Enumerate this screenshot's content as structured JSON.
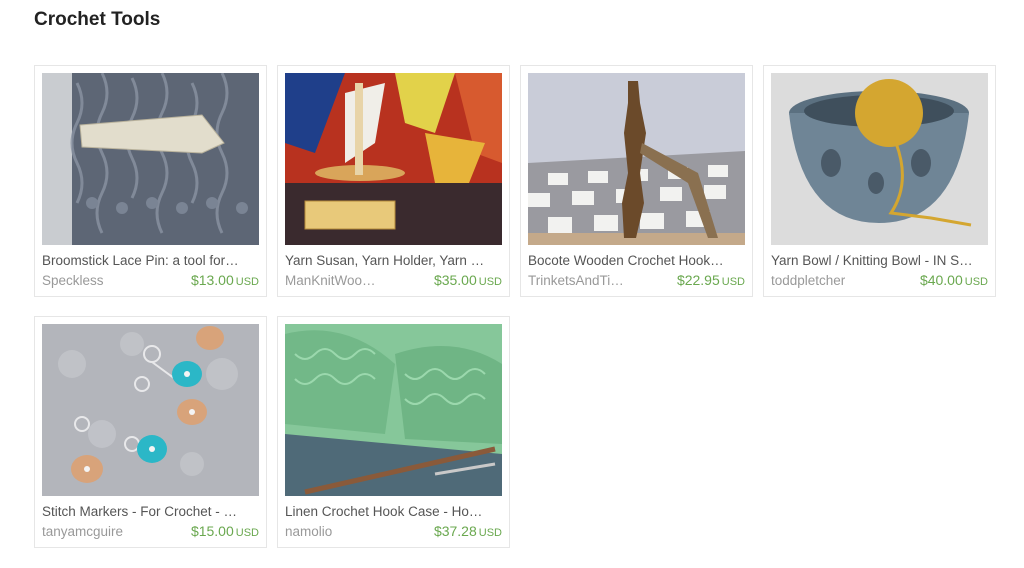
{
  "page": {
    "title": "Crochet Tools"
  },
  "listings": [
    {
      "title": "Broomstick Lace Pin: a tool for…",
      "shop": "Speckless",
      "price": "$13.00",
      "currency": "USD",
      "image_icon": "broomstick-lace-pin-image"
    },
    {
      "title": "Yarn Susan, Yarn Holder, Yarn …",
      "shop": "ManKnitWoo…",
      "price": "$35.00",
      "currency": "USD",
      "image_icon": "yarn-susan-image"
    },
    {
      "title": "Bocote Wooden Crochet Hook…",
      "shop": "TrinketsAndTi…",
      "price": "$22.95",
      "currency": "USD",
      "image_icon": "wooden-crochet-hook-image"
    },
    {
      "title": "Yarn Bowl / Knitting Bowl - IN S…",
      "shop": "toddpletcher",
      "price": "$40.00",
      "currency": "USD",
      "image_icon": "yarn-bowl-image"
    },
    {
      "title": "Stitch Markers - For Crochet - …",
      "shop": "tanyamcguire",
      "price": "$15.00",
      "currency": "USD",
      "image_icon": "stitch-markers-image"
    },
    {
      "title": "Linen Crochet Hook Case - Ho…",
      "shop": "namolio",
      "price": "$37.28",
      "currency": "USD",
      "image_icon": "crochet-hook-case-image"
    }
  ],
  "colors": {
    "price": "#6aa84f",
    "shop": "#999999",
    "title": "#555555"
  }
}
